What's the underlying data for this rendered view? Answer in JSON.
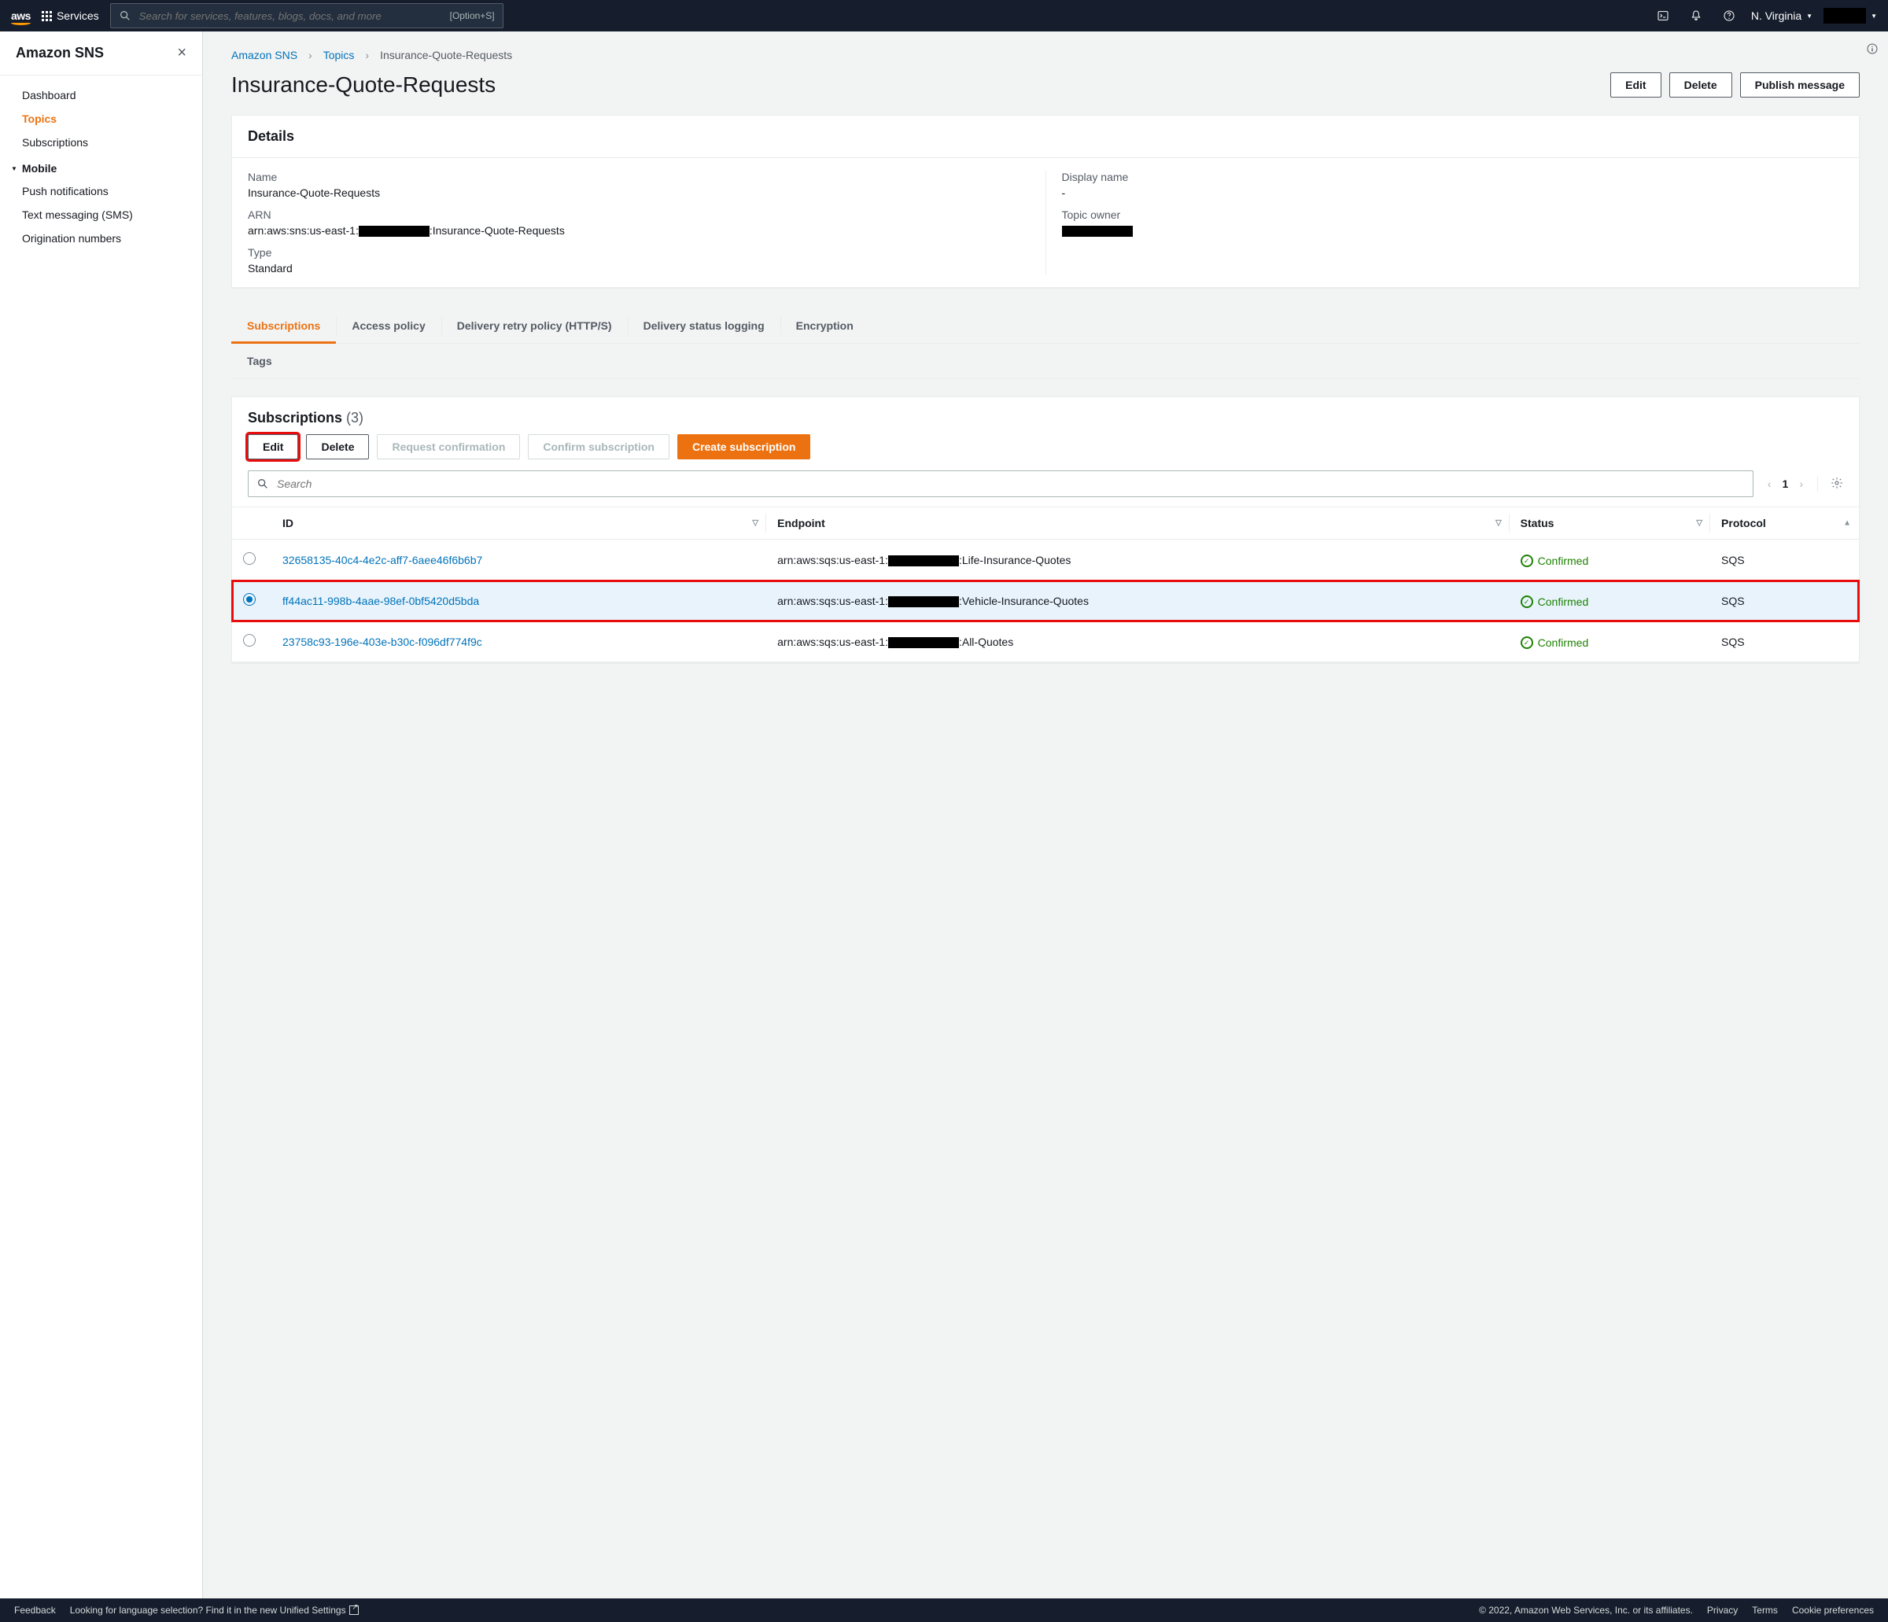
{
  "topbar": {
    "logo_text": "aws",
    "services_label": "Services",
    "search_placeholder": "Search for services, features, blogs, docs, and more",
    "search_kbd": "[Option+S]",
    "region": "N. Virginia"
  },
  "sidebar": {
    "title": "Amazon SNS",
    "items": [
      "Dashboard",
      "Topics",
      "Subscriptions"
    ],
    "active_index": 1,
    "mobile_header": "Mobile",
    "mobile_items": [
      "Push notifications",
      "Text messaging (SMS)",
      "Origination numbers"
    ]
  },
  "breadcrumb": {
    "items": [
      "Amazon SNS",
      "Topics",
      "Insurance-Quote-Requests"
    ]
  },
  "page": {
    "title": "Insurance-Quote-Requests",
    "buttons": {
      "edit": "Edit",
      "delete": "Delete",
      "publish": "Publish message"
    }
  },
  "details": {
    "header": "Details",
    "name_label": "Name",
    "name_value": "Insurance-Quote-Requests",
    "arn_label": "ARN",
    "arn_prefix": "arn:aws:sns:us-east-1:",
    "arn_suffix": ":Insurance-Quote-Requests",
    "type_label": "Type",
    "type_value": "Standard",
    "display_label": "Display name",
    "display_value": "-",
    "owner_label": "Topic owner"
  },
  "tabs": {
    "row1": [
      "Subscriptions",
      "Access policy",
      "Delivery retry policy (HTTP/S)",
      "Delivery status logging",
      "Encryption"
    ],
    "row2": [
      "Tags"
    ],
    "active_index": 0
  },
  "subscriptions": {
    "header": "Subscriptions",
    "count": "(3)",
    "toolbar": {
      "edit": "Edit",
      "delete": "Delete",
      "req_conf": "Request confirmation",
      "conf_sub": "Confirm subscription",
      "create": "Create subscription"
    },
    "search_placeholder": "Search",
    "page_num": "1",
    "columns": [
      "ID",
      "Endpoint",
      "Status",
      "Protocol"
    ],
    "rows": [
      {
        "selected": false,
        "id": "32658135-40c4-4e2c-aff7-6aee46f6b6b7",
        "ep_prefix": "arn:aws:sqs:us-east-1:",
        "ep_suffix": ":Life-Insurance-Quotes",
        "status": "Confirmed",
        "protocol": "SQS"
      },
      {
        "selected": true,
        "id": "ff44ac11-998b-4aae-98ef-0bf5420d5bda",
        "ep_prefix": "arn:aws:sqs:us-east-1:",
        "ep_suffix": ":Vehicle-Insurance-Quotes",
        "status": "Confirmed",
        "protocol": "SQS"
      },
      {
        "selected": false,
        "id": "23758c93-196e-403e-b30c-f096df774f9c",
        "ep_prefix": "arn:aws:sqs:us-east-1:",
        "ep_suffix": ":All-Quotes",
        "status": "Confirmed",
        "protocol": "SQS"
      }
    ]
  },
  "footer": {
    "feedback": "Feedback",
    "lang_hint": "Looking for language selection? Find it in the new ",
    "unified_label": "Unified Settings",
    "copyright": "© 2022, Amazon Web Services, Inc. or its affiliates.",
    "links": [
      "Privacy",
      "Terms",
      "Cookie preferences"
    ]
  }
}
